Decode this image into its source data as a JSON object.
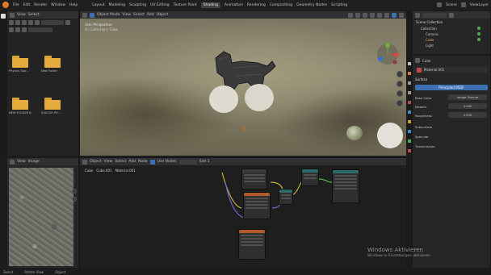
{
  "menubar": {
    "items": [
      "File",
      "Edit",
      "Render",
      "Window",
      "Help"
    ],
    "workspaces": [
      "Layout",
      "Modeling",
      "Sculpting",
      "UV Editing",
      "Texture Paint",
      "Shading",
      "Animation",
      "Rendering",
      "Compositing",
      "Geometry Nodes",
      "Scripting"
    ],
    "active_workspace": "Shading",
    "scene_label": "Scene",
    "viewlayer_label": "ViewLayer"
  },
  "file_browser": {
    "header": [
      "View",
      "Select"
    ],
    "folders": [
      "Physics Stor...",
      "New Folder",
      "NEW FOLDER B",
      "SAUCER PIC..."
    ]
  },
  "viewport": {
    "header": [
      "Object Mode",
      "View",
      "Select",
      "Add",
      "Object"
    ],
    "info_line1": "User Perspective",
    "info_line2": "(1) Collection | Cube",
    "shading_mode": "Material Preview"
  },
  "node_editor": {
    "header": [
      "Object",
      "View",
      "Select",
      "Add",
      "Node",
      "Use Nodes"
    ],
    "breadcrumb": [
      "Cube",
      "Cube.001",
      "Material.001"
    ],
    "slot": "Slot 1"
  },
  "texture_view": {
    "header": [
      "View",
      "Image"
    ]
  },
  "outliner": {
    "header": "Scene Collection",
    "items": [
      "Collection",
      "Camera",
      "Cube",
      "Light"
    ]
  },
  "properties": {
    "object_name": "Cube",
    "material_name": "Material.001",
    "surface_label": "Surface",
    "shader": "Principled BSDF",
    "rows": [
      {
        "label": "Base Color",
        "value": "Image Texture"
      },
      {
        "label": "Metallic",
        "value": "0.000"
      },
      {
        "label": "Roughness",
        "value": "0.500"
      }
    ],
    "sections": [
      "Subsurface",
      "Specular",
      "Transmission"
    ]
  },
  "statusbar": {
    "left": "Select",
    "middle": "Rotate View",
    "right": "Object"
  },
  "watermark": {
    "line1": "Windows Aktivieren",
    "line2": "Windows in Einstellungen aktivieren"
  },
  "colors": {
    "accent": "#3d6fb3",
    "folder": "#e5ac3d",
    "viewport_bg": "#8f8a70",
    "node_teal_header": "#2d6b6b",
    "node_orange_header": "#b35a2a"
  }
}
